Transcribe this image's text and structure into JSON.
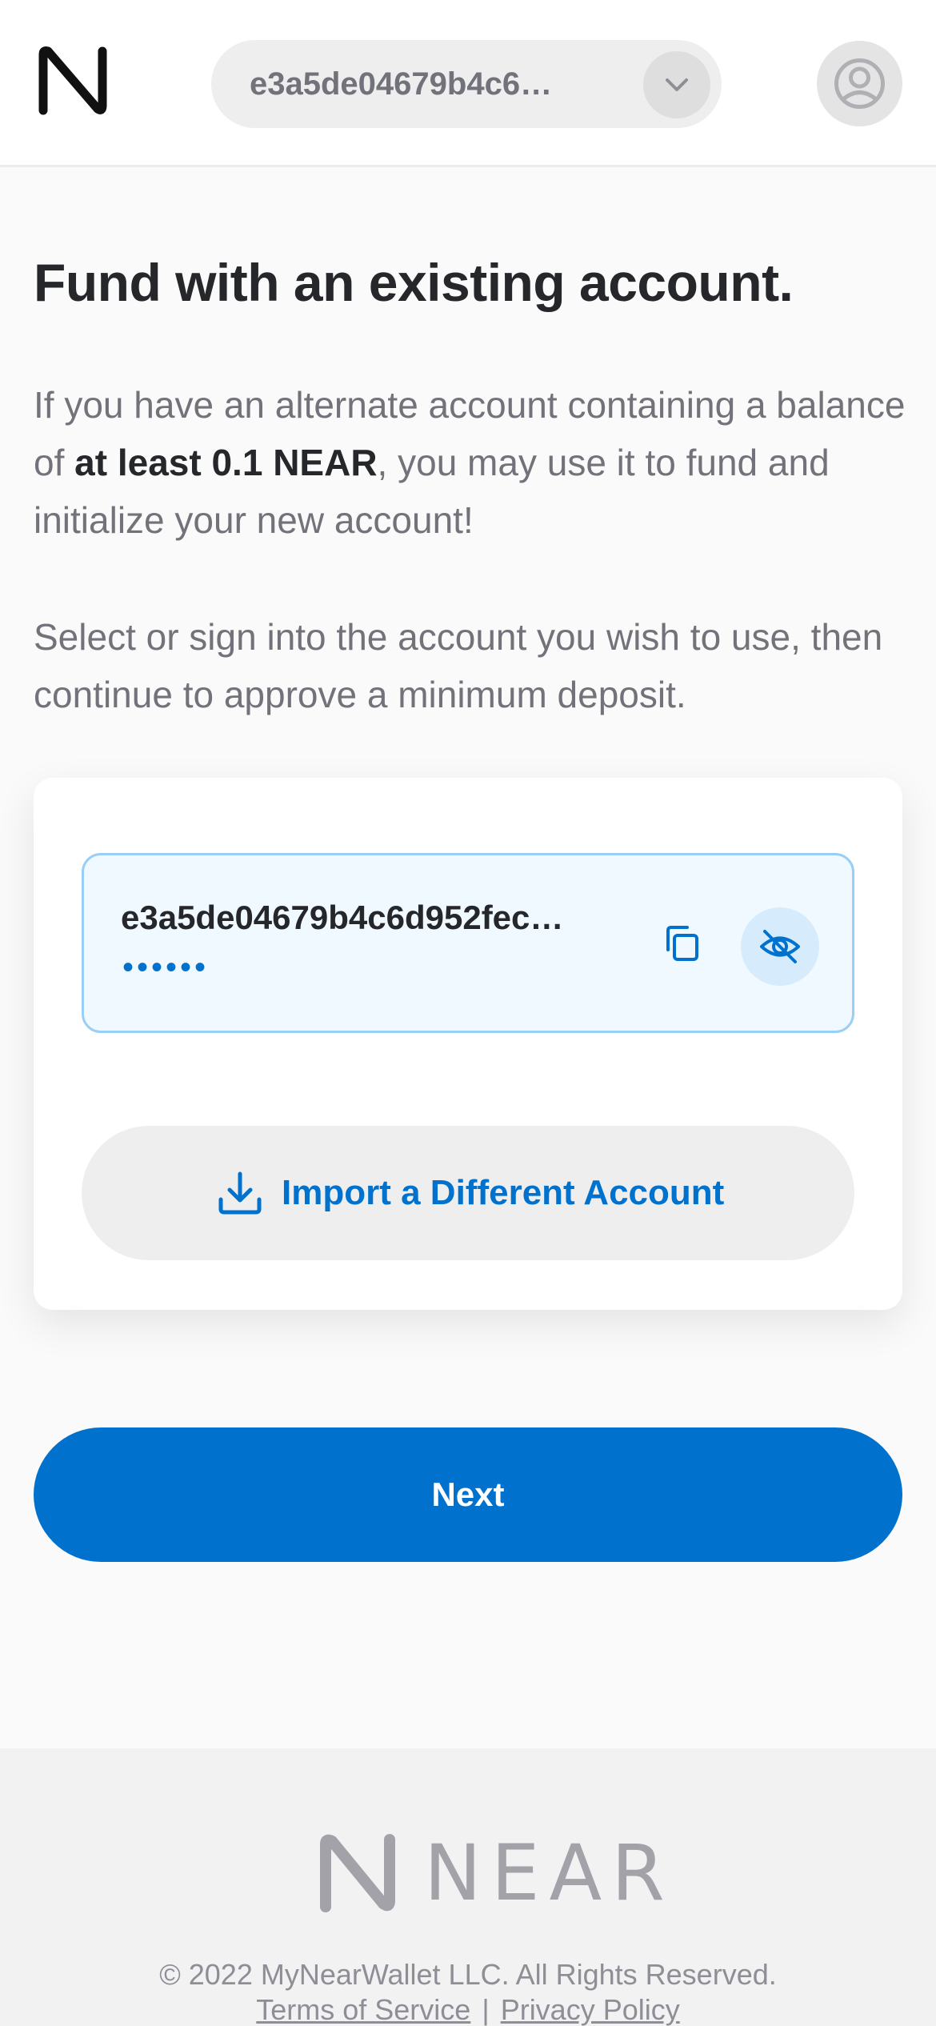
{
  "header": {
    "logo_icon": "near-n-logo-icon",
    "account_selector_text": "e3a5de04679b4c6…",
    "dropdown_icon": "chevron-down-icon",
    "user_icon": "user-account-icon"
  },
  "main": {
    "title": "Fund with an existing account.",
    "para1_before": "If you have an alternate account containing a balance of ",
    "para1_bold": "at least 0.1 NEAR",
    "para1_after": ", you may use it to fund and initialize your new account!",
    "para2": "Select or sign into the account you wish to use, then continue to approve a minimum deposit."
  },
  "account_card": {
    "account_id": "e3a5de04679b4c6d952fec…",
    "balance_masked": "••••••",
    "copy_icon": "copy-icon",
    "visibility_icon": "eye-off-icon",
    "import_label": "Import a Different Account",
    "import_icon": "download-icon"
  },
  "actions": {
    "next_label": "Next"
  },
  "footer": {
    "brand_word": "NEAR",
    "copyright": "© 2022 MyNearWallet LLC. All Rights Reserved.",
    "terms_label": "Terms of Service",
    "separator": "|",
    "privacy_label": "Privacy Policy"
  },
  "colors": {
    "primary": "#0072ce",
    "text_dark": "#25272a",
    "text_muted": "#72727a",
    "account_box_bg": "#f0f9ff",
    "account_box_border": "#99cef5"
  }
}
